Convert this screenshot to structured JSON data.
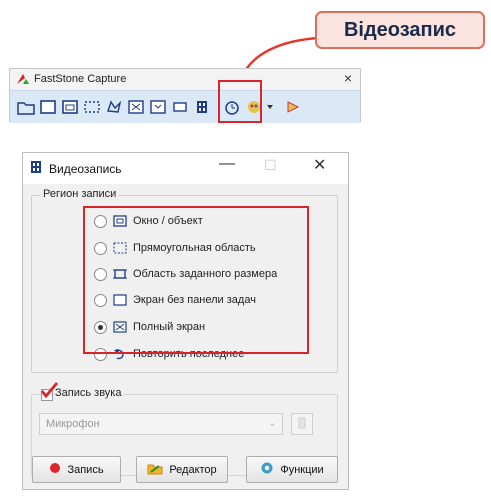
{
  "callout": {
    "text": "Відеозапис"
  },
  "faststone": {
    "title": "FastStone Capture",
    "close_symbol": "×",
    "toolbar_icons": [
      "open-folder-icon",
      "active-window-icon",
      "window-object-icon",
      "rectangular-region-icon",
      "freehand-region-icon",
      "fullscreen-icon",
      "scrolling-window-icon",
      "fixed-region-icon",
      "screen-recorder-icon",
      "timer-icon",
      "output-color-icon",
      "dropdown-arrow-icon",
      "settings-icon"
    ]
  },
  "dialog": {
    "title": "Видеозапись",
    "minimize_symbol": "—",
    "maximize_symbol": "☐",
    "close_symbol": "✕",
    "region_group": {
      "label": "Регион записи",
      "options": [
        {
          "label": "Окно / объект",
          "icon": "window-object-icon",
          "selected": false
        },
        {
          "label": "Прямоугольная область",
          "icon": "rectangular-region-icon",
          "selected": false
        },
        {
          "label": "Область заданного размера",
          "icon": "fixed-region-icon",
          "selected": false
        },
        {
          "label": "Экран без панели задач",
          "icon": "screen-no-taskbar-icon",
          "selected": false
        },
        {
          "label": "Полный экран",
          "icon": "fullscreen-icon",
          "selected": true
        },
        {
          "label": "Повторить последнее",
          "icon": "repeat-icon",
          "selected": false
        }
      ]
    },
    "sound_group": {
      "label": "Запись звука",
      "checked": true,
      "source": "Микрофон"
    },
    "buttons": {
      "record": "Запись",
      "editor": "Редактор",
      "functions": "Функции"
    }
  },
  "colors": {
    "highlight_red": "#d7262b",
    "callout_fill": "#fbe3df",
    "callout_border": "#e06c5c",
    "toolbar_bg": "#dbe8f6"
  }
}
